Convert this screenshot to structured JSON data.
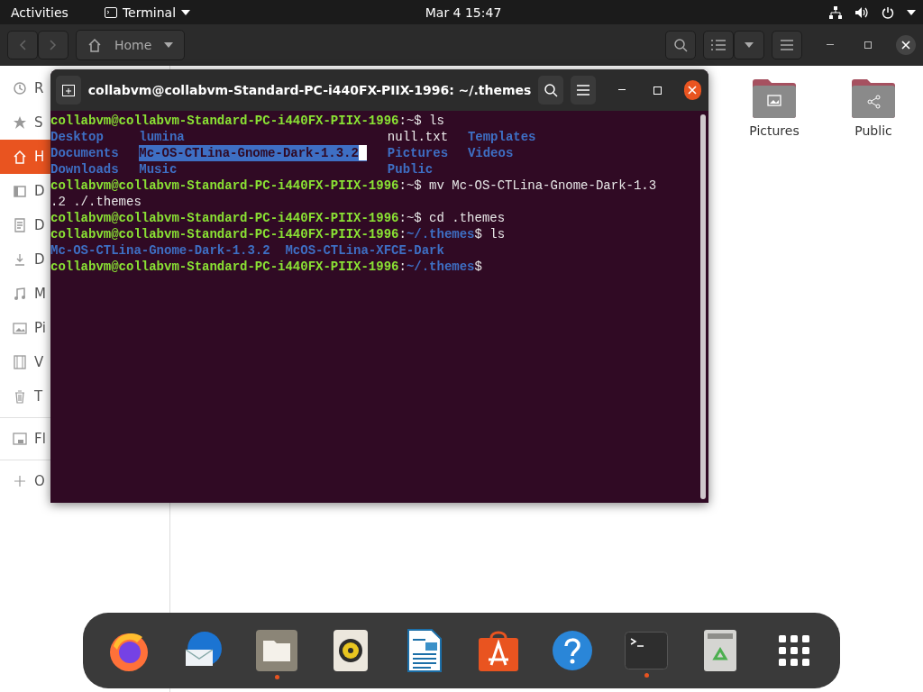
{
  "top_bar": {
    "activities": "Activities",
    "app_menu": "Terminal",
    "clock": "Mar 4  15:47"
  },
  "files_window": {
    "header": {
      "location": "Home"
    },
    "sidebar": {
      "items": [
        {
          "kind": "recent",
          "label": "R",
          "selected": false
        },
        {
          "kind": "starred",
          "label": "S",
          "selected": false
        },
        {
          "kind": "home",
          "label": "H",
          "selected": true
        },
        {
          "kind": "desktop",
          "label": "D",
          "selected": false
        },
        {
          "kind": "documents",
          "label": "D",
          "selected": false
        },
        {
          "kind": "downloads",
          "label": "D",
          "selected": false
        },
        {
          "kind": "music",
          "label": "M",
          "selected": false
        },
        {
          "kind": "pictures",
          "label": "Pi",
          "selected": false
        },
        {
          "kind": "videos",
          "label": "V",
          "selected": false
        },
        {
          "kind": "trash",
          "label": "T",
          "selected": false
        },
        {
          "kind": "drive",
          "label": "Fl",
          "selected": false
        },
        {
          "kind": "other",
          "label": "O",
          "selected": false
        }
      ]
    },
    "folders": [
      {
        "kind": "pictures",
        "label": "Pictures"
      },
      {
        "kind": "public",
        "label": "Public"
      }
    ]
  },
  "terminal": {
    "title": "collabvm@collabvm-Standard-PC-i440FX-PIIX-1996: ~/.themes",
    "lines": [
      {
        "kind": "prompt",
        "user": "collabvm@collabvm-Standard-PC-i440FX-PIIX-1996",
        "sep": ":",
        "path": "~",
        "prompt_char": "$",
        "command": "ls"
      },
      {
        "kind": "ls",
        "columns": [
          [
            {
              "text": "Desktop",
              "dir": true,
              "selected": false
            },
            {
              "text": "Documents",
              "dir": true,
              "selected": false
            },
            {
              "text": "Downloads",
              "dir": true,
              "selected": false
            }
          ],
          [
            {
              "text": "lumina",
              "dir": true,
              "selected": false
            },
            {
              "text": "Mc-OS-CTLina-Gnome-Dark-1.3.2",
              "dir": true,
              "selected": true
            },
            {
              "text": "Music",
              "dir": true,
              "selected": false
            }
          ],
          [
            {
              "text": "null.txt",
              "dir": false,
              "selected": false
            },
            {
              "text": "Pictures",
              "dir": true,
              "selected": false
            },
            {
              "text": "Public",
              "dir": true,
              "selected": false
            }
          ],
          [
            {
              "text": "Templates",
              "dir": true,
              "selected": false
            },
            {
              "text": "Videos",
              "dir": true,
              "selected": false
            }
          ]
        ]
      },
      {
        "kind": "prompt",
        "user": "collabvm@collabvm-Standard-PC-i440FX-PIIX-1996",
        "sep": ":",
        "path": "~",
        "prompt_char": "$",
        "command": "mv Mc-OS-CTLina-Gnome-Dark-1.3"
      },
      {
        "kind": "output",
        "text": ".2 ./.themes"
      },
      {
        "kind": "prompt",
        "user": "collabvm@collabvm-Standard-PC-i440FX-PIIX-1996",
        "sep": ":",
        "path": "~",
        "prompt_char": "$",
        "command": "cd .themes"
      },
      {
        "kind": "prompt",
        "user": "collabvm@collabvm-Standard-PC-i440FX-PIIX-1996",
        "sep": ":",
        "path": "~/.themes",
        "prompt_char": "$",
        "command": "ls"
      },
      {
        "kind": "ls",
        "columns": [
          [
            {
              "text": "Mc-OS-CTLina-Gnome-Dark-1.3.2",
              "dir": true,
              "selected": false
            }
          ],
          [
            {
              "text": "McOS-CTLina-XFCE-Dark",
              "dir": true,
              "selected": false
            }
          ]
        ]
      },
      {
        "kind": "prompt",
        "user": "collabvm@collabvm-Standard-PC-i440FX-PIIX-1996",
        "sep": ":",
        "path": "~/.themes",
        "prompt_char": "$"
      }
    ]
  },
  "dock": {
    "items": [
      {
        "kind": "browser",
        "running": false
      },
      {
        "kind": "mail",
        "running": false
      },
      {
        "kind": "files",
        "running": true
      },
      {
        "kind": "music",
        "running": false
      },
      {
        "kind": "writer",
        "running": false
      },
      {
        "kind": "store",
        "running": false
      },
      {
        "kind": "help",
        "running": false
      },
      {
        "kind": "terminal",
        "running": true
      },
      {
        "kind": "trash",
        "running": false
      },
      {
        "kind": "apps",
        "running": false
      }
    ]
  }
}
